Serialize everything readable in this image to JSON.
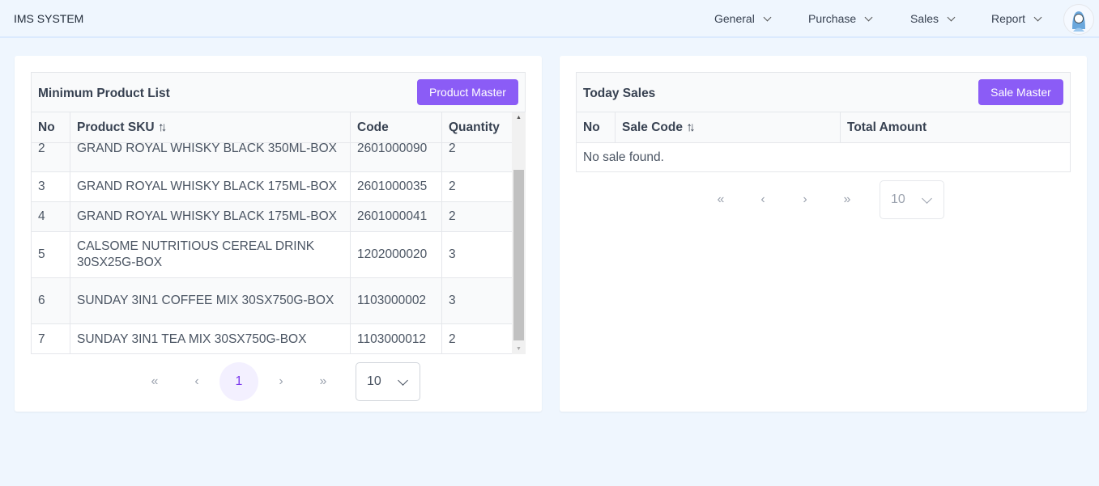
{
  "header": {
    "brand": "IMS SYSTEM",
    "nav": [
      "General",
      "Purchase",
      "Sales",
      "Report"
    ]
  },
  "left": {
    "title": "Minimum Product List",
    "button": "Product Master",
    "columns": [
      "No",
      "Product SKU",
      "Code",
      "Quantity"
    ],
    "sort_icon": "↑↓",
    "rows": [
      {
        "no": "2",
        "sku": "GRAND ROYAL WHISKY BLACK 350ML-BOX",
        "code": "2601000090",
        "qty": "2"
      },
      {
        "no": "3",
        "sku": "GRAND ROYAL WHISKY BLACK 175ML-BOX",
        "code": "2601000035",
        "qty": "2"
      },
      {
        "no": "4",
        "sku": "GRAND ROYAL WHISKY BLACK 175ML-BOX",
        "code": "2601000041",
        "qty": "2"
      },
      {
        "no": "5",
        "sku": "CALSOME NUTRITIOUS CEREAL DRINK 30SX25G-BOX",
        "code": "1202000020",
        "qty": "3"
      },
      {
        "no": "6",
        "sku": "SUNDAY 3IN1 COFFEE MIX 30SX750G-BOX",
        "code": "1103000002",
        "qty": "3"
      },
      {
        "no": "7",
        "sku": "SUNDAY 3IN1 TEA MIX 30SX750G-BOX",
        "code": "1103000012",
        "qty": "2"
      }
    ],
    "pager": {
      "first": "«",
      "prev": "‹",
      "page": "1",
      "next": "›",
      "last": "»",
      "per_page": "10"
    }
  },
  "right": {
    "title": "Today Sales",
    "button": "Sale Master",
    "columns": [
      "No",
      "Sale Code",
      "Total Amount"
    ],
    "sort_icon": "↑↓",
    "empty": "No sale found.",
    "pager": {
      "first": "«",
      "prev": "‹",
      "next": "›",
      "last": "»",
      "per_page": "10"
    }
  }
}
